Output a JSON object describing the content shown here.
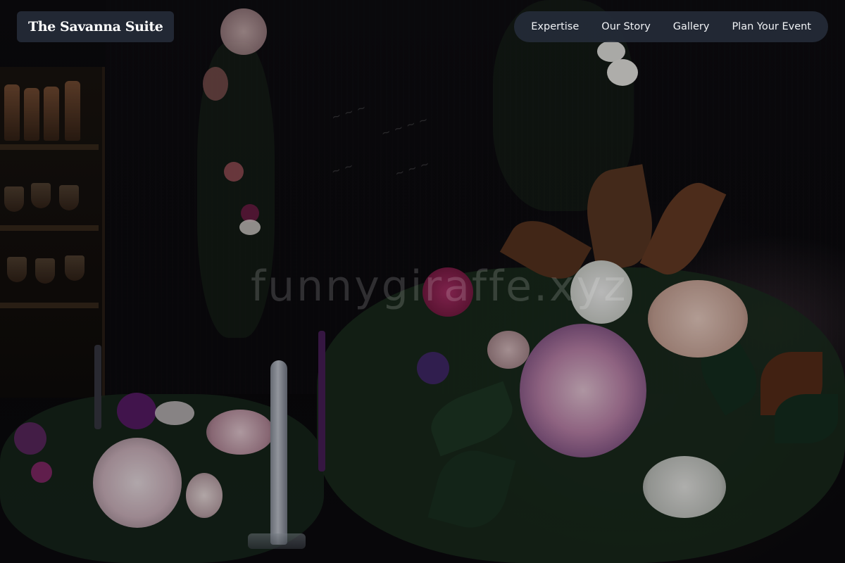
{
  "brand": {
    "name": "The Savanna Suite"
  },
  "nav": {
    "items": [
      {
        "label": "Expertise"
      },
      {
        "label": "Our Story"
      },
      {
        "label": "Gallery"
      },
      {
        "label": "Plan Your Event"
      }
    ]
  },
  "hero": {
    "watermark": "funnygiraffe.xyz",
    "image_subject": "floral-arrangement-photo"
  },
  "colors": {
    "nav_background": "#262c3a",
    "text": "#ffffff"
  }
}
